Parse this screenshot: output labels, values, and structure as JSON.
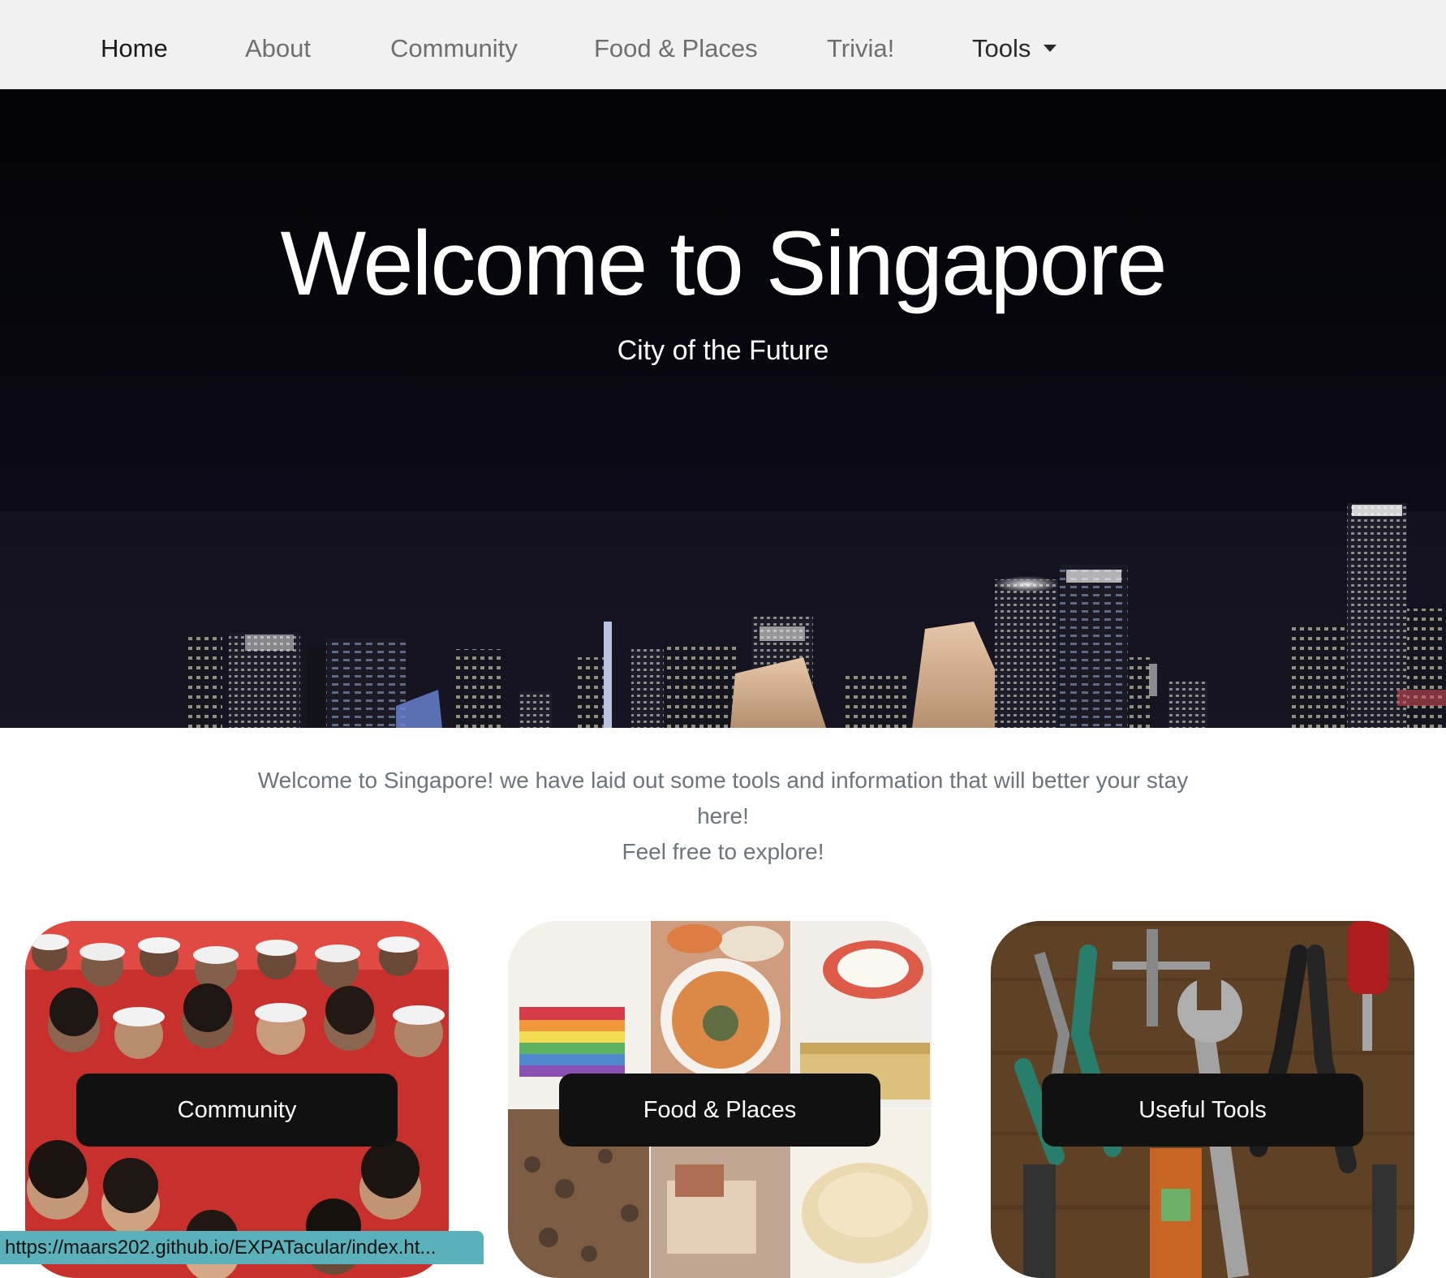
{
  "nav": {
    "items": [
      {
        "label": "Home",
        "active": true
      },
      {
        "label": "About",
        "active": false
      },
      {
        "label": "Community",
        "active": false
      },
      {
        "label": "Food & Places",
        "active": false
      },
      {
        "label": "Trivia!",
        "active": false
      },
      {
        "label": "Tools",
        "active": false,
        "dropdown": true
      }
    ]
  },
  "hero": {
    "title": "Welcome to Singapore",
    "subtitle": "City of the Future",
    "background": "night-skyline-image"
  },
  "intro": {
    "line1": "Welcome to Singapore! we have laid out some tools and information that will better your stay here!",
    "line2": "Feel free to explore!"
  },
  "cards": [
    {
      "label": "Community",
      "image": "crowd-in-red-image"
    },
    {
      "label": "Food & Places",
      "image": "local-food-collage-image"
    },
    {
      "label": "Useful Tools",
      "image": "hand-tools-image"
    }
  ],
  "status_bar": {
    "url": "https://maars202.github.io/EXPATacular/index.ht..."
  },
  "colors": {
    "nav_background": "#f1f1f1",
    "nav_text": "#6f6f6f",
    "nav_active": "#1a1a1a",
    "intro_text": "#6c757d",
    "card_label_bg": "#111111",
    "status_bar_bg": "#5ab1ba"
  }
}
